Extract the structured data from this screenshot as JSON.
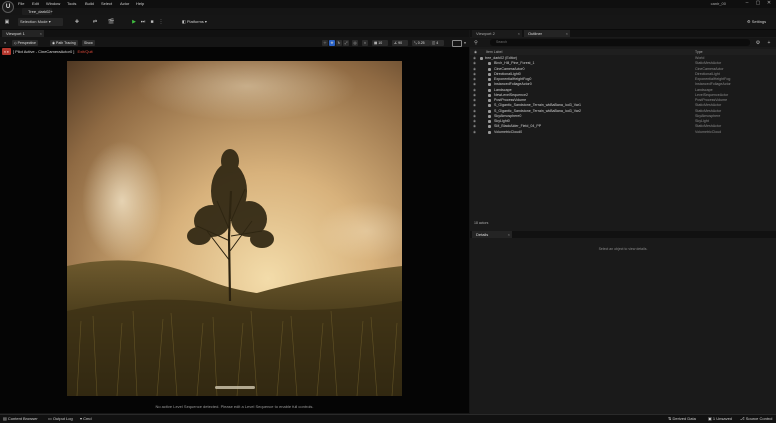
{
  "app": {
    "logo": "U",
    "project": "canir_00"
  },
  "menu": [
    "File",
    "Edit",
    "Window",
    "Tools",
    "Build",
    "Select",
    "Actor",
    "Help"
  ],
  "level_tab": "Tree_dark02+",
  "toolbar": {
    "mode": "Selection Mode",
    "platforms": "Platforms",
    "settings": "Settings"
  },
  "viewport": {
    "tab": "Viewport 1",
    "perspective": "Perspective",
    "path_tracing": "Path Tracing",
    "show": "Show",
    "pilot_badge": "",
    "pilot_text": "[ Pilot Active - CineCameraActor0 ]",
    "pilot_exit": "Exit/Quit",
    "fov": "90",
    "snap": "10",
    "speed": "0.25",
    "cam": "4",
    "sequence_msg": "No active Level Sequence detected. Please edit a Level Sequence to enable full controls."
  },
  "right_panel": {
    "tab_viewport2": "Viewport 2",
    "tab_outliner": "Outliner",
    "search_placeholder": "Search",
    "col_label": "Item Label",
    "col_type": "Type",
    "actor_count": "18 actors",
    "details_tab": "Details",
    "details_msg": "Select an object to view details."
  },
  "outliner": [
    {
      "label": "tree_dark02 (Editor)",
      "type": "World",
      "indent": 0
    },
    {
      "label": "Birch_Hill_Pine_Forest_1",
      "type": "StaticMeshActor",
      "indent": 1
    },
    {
      "label": "CineCameraActor0",
      "type": "CineCameraActor",
      "indent": 1
    },
    {
      "label": "DirectionalLight0",
      "type": "DirectionalLight",
      "indent": 1
    },
    {
      "label": "ExponentialHeightFog0",
      "type": "ExponentialHeightFog",
      "indent": 1
    },
    {
      "label": "InstancedFoliageActor0",
      "type": "InstancedFoliageActor",
      "indent": 1
    },
    {
      "label": "Landscape",
      "type": "Landscape",
      "indent": 1
    },
    {
      "label": "NewLevelSequence2",
      "type": "LevelSequenceActor",
      "indent": 1
    },
    {
      "label": "PostProcessVolume",
      "type": "PostProcessVolume",
      "indent": 1
    },
    {
      "label": "S_Gigantic_Sandstone_Terrain_wkBaBana_lod3_Var1",
      "type": "StaticMeshActor",
      "indent": 1
    },
    {
      "label": "S_Gigantic_Sandstone_Terrain_wkBaBana_lod3_Var2",
      "type": "StaticMeshActor",
      "indent": 1
    },
    {
      "label": "SkyAtmosphere0",
      "type": "SkyAtmosphere",
      "indent": 1
    },
    {
      "label": "SkyLight0",
      "type": "SkyLight",
      "indent": 1
    },
    {
      "label": "SM_BlackAlder_Field_04_PP",
      "type": "StaticMeshActor",
      "indent": 1
    },
    {
      "label": "VolumetricCloud0",
      "type": "VolumetricCloud",
      "indent": 1
    }
  ],
  "bottom": {
    "content_browser": "Content Browser",
    "output_log": "Output Log",
    "cmd": "Cmd",
    "derived": "Derived Data",
    "unsaved": "1 Unsaved",
    "source": "Source Control"
  }
}
